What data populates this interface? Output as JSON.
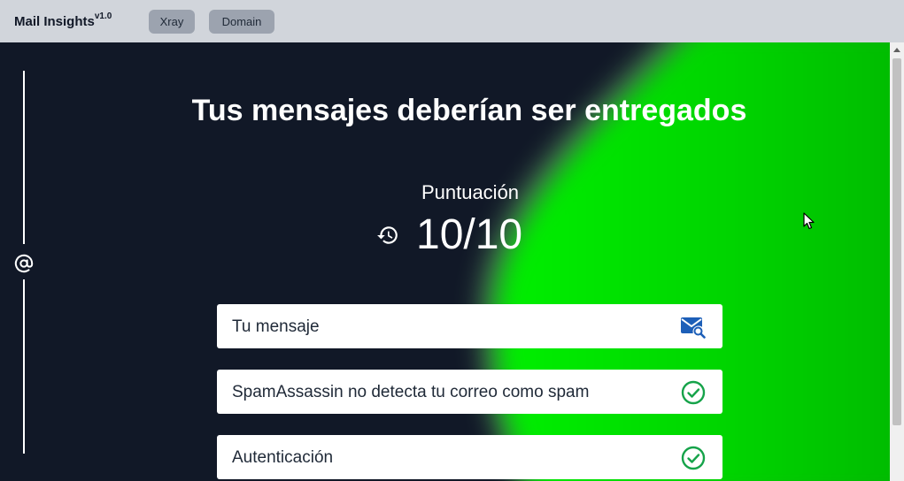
{
  "header": {
    "app_name": "Mail Insights",
    "version": "v1.0",
    "nav": [
      {
        "label": "Xray"
      },
      {
        "label": "Domain"
      }
    ]
  },
  "sidebar": {
    "icon": "at-icon"
  },
  "main": {
    "headline": "Tus mensajes deberían ser entregados",
    "score_label": "Puntuación",
    "score_value": "10/10",
    "score_icon": "history-icon",
    "checks": [
      {
        "label": "Tu mensaje",
        "icon": "mail-search-icon",
        "icon_color": "#1d5fb8"
      },
      {
        "label": "SpamAssassin no detecta tu correo como spam",
        "icon": "check-circle-icon",
        "icon_color": "#16a34a"
      },
      {
        "label": "Autenticación",
        "icon": "check-circle-icon",
        "icon_color": "#16a34a"
      }
    ]
  },
  "colors": {
    "topbar_bg": "#d1d5db",
    "main_bg": "#111827",
    "accent_green": "#00e600"
  }
}
